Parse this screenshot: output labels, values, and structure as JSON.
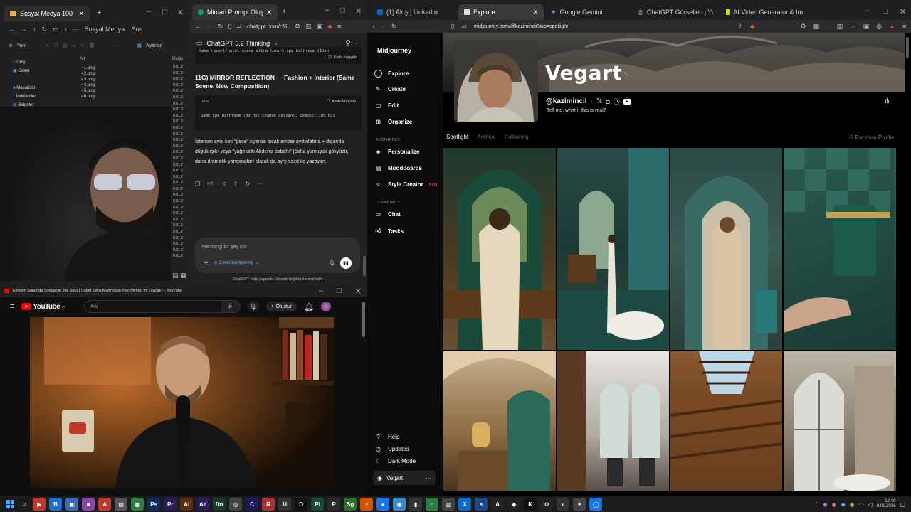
{
  "explorer": {
    "tab_title": "Sosyal Medya 100",
    "address": "Sosyal Medya",
    "search": "Sosyal Medya ara",
    "new_label": "Yeni",
    "options_label": "Ayarlar",
    "col_name": "Ad",
    "col_date": "Değiş",
    "sidebar": [
      "Giriş",
      "Galeri",
      "Masaüstü",
      "İndirilenler",
      "Belgeler"
    ],
    "files": [
      "1.png",
      "2.png",
      "3.png",
      "4.png",
      "5.png",
      "6.png"
    ],
    "date_short": "9.01.2"
  },
  "chatgpt": {
    "tab_title": "Mimari Prompt Oluşturma",
    "url": "chatgpt.com/c/6",
    "model": "ChatGPT 5.2 Thinking",
    "top_code": "Same resort/hotel scene ultra luxury spa bathroom (Iden",
    "copy_label": "Kodu kopyala",
    "heading": "11G) MIRROR REFLECTION — Fashion + Interior (Same Scene, New Composition)",
    "code_lang": "text",
    "code_line": "Same spa bathroom (do not change design), composition bui",
    "body_text": "İstersen aynı seti \"gece\" (içeride sıcak amber aydınlatma + dışarıda düşük ışık) veya \"yağmurlu Akdeniz sabahı\" (daha yumuşak gökyüzü, daha dramatik yansımalar) olarak da aynı seed ile yazayım.",
    "input_placeholder": "Herhangi bir şey sor",
    "extended": "Extended thinking",
    "disclaimer": "ChatGPT hata yapabilir. Önemli bilgileri kontrol edin."
  },
  "youtube": {
    "window_title": "Evrenin Sonunda Sorulacak Tek Soru | Süper Zeka Kozmosun Yeni Mimarı mı Olacak? - YouTube",
    "logo": "YouTube",
    "logo_sup": "TR",
    "search_placeholder": "Ara",
    "create": "Oluştur"
  },
  "browser": {
    "tabs": [
      "(1) Akış | LinkedIn",
      "Explore",
      "Google Gemini",
      "ChatGPT Görselleri | Yapay Zekalı Gö",
      "AI Video Generator & Image Generat"
    ],
    "url": "midjourney.com/@kazimincii?tab=spotlight"
  },
  "midjourney": {
    "brand": "Midjourney",
    "nav": [
      "Explore",
      "Create",
      "Edit",
      "Organize"
    ],
    "aesthetics_label": "AESTHETICS",
    "aesthetics": [
      "Personalize",
      "Moodboards",
      "Style Creator"
    ],
    "beta": "Beta",
    "community_label": "COMMUNITY",
    "community": [
      "Chat",
      "Tasks"
    ],
    "bottom": [
      "Help",
      "Updates",
      "Dark Mode"
    ],
    "user": "Vegart",
    "profile_name": "Vegart",
    "handle": "@kazimincii",
    "bio": "Tell me, what if this is real?",
    "tabs": [
      "Spotlight",
      "Archive",
      "Following"
    ],
    "random": "Random Profile"
  },
  "taskbar": {
    "time": "19:40",
    "date": "9.01.2026",
    "apps": [
      {
        "t": "▶",
        "c": "#c0392b"
      },
      {
        "t": "B",
        "c": "#1e6fcf"
      },
      {
        "t": "▣",
        "c": "#3c6bb5"
      },
      {
        "t": "■",
        "c": "#8e44ad"
      },
      {
        "t": "A",
        "c": "#c0392b"
      },
      {
        "t": "▤",
        "c": "#555"
      },
      {
        "t": "▦",
        "c": "#2d7d46"
      },
      {
        "t": "Ps",
        "c": "#0a2d5e"
      },
      {
        "t": "Pr",
        "c": "#2a1a5e"
      },
      {
        "t": "Ai",
        "c": "#5a2d0c"
      },
      {
        "t": "Ae",
        "c": "#2a1a5e"
      },
      {
        "t": "Dn",
        "c": "#1a3a2a"
      },
      {
        "t": "◎",
        "c": "#444"
      },
      {
        "t": "C",
        "c": "#1a1a5e"
      },
      {
        "t": "R",
        "c": "#a83232"
      },
      {
        "t": "U",
        "c": "#333"
      },
      {
        "t": "D",
        "c": "#111"
      },
      {
        "t": "Pl",
        "c": "#1a4a3a"
      },
      {
        "t": "P",
        "c": "#2a2a2a"
      },
      {
        "t": "Sg",
        "c": "#2d6d2d"
      },
      {
        "t": "⚡",
        "c": "#d35400"
      },
      {
        "t": "●",
        "c": "#1a73e8"
      },
      {
        "t": "◉",
        "c": "#3a8ad0"
      },
      {
        "t": "▮",
        "c": "#333"
      },
      {
        "t": "○",
        "c": "#2d7d46"
      },
      {
        "t": "▥",
        "c": "#444"
      },
      {
        "t": "X",
        "c": "#0a6ad0"
      },
      {
        "t": "✕",
        "c": "#1d4a8a"
      },
      {
        "t": "A",
        "c": "#222"
      },
      {
        "t": "◆",
        "c": "#222"
      },
      {
        "t": "K",
        "c": "#111"
      },
      {
        "t": "⚙",
        "c": "#222"
      },
      {
        "t": "◐",
        "c": "#333"
      },
      {
        "t": "✦",
        "c": "#444"
      },
      {
        "t": "◯",
        "c": "#1a73e8"
      }
    ]
  }
}
